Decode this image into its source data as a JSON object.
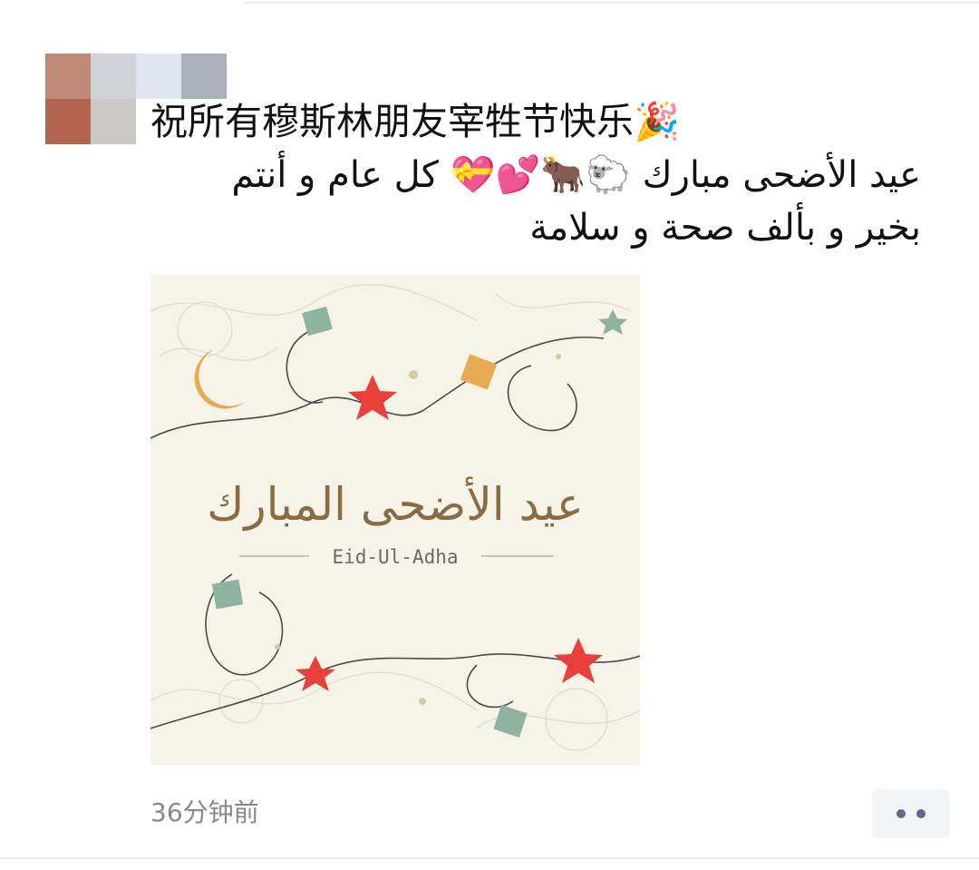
{
  "post": {
    "line_cn": "祝所有穆斯林朋友宰牲节快乐🎉",
    "line_ar_1": "عيد الأضحى مبارك 🐑🐂💕💝 كل عام و أنتم",
    "line_ar_2": "بخير و بألف صحة و سلامة"
  },
  "image": {
    "arabic_calligraphy": "عيد الأضحى المبارك",
    "caption": "Eid-Ul-Adha"
  },
  "footer": {
    "timestamp": "36分钟前"
  },
  "colors": {
    "card_bg": "#f6f3e9",
    "gold": "#e7aa52",
    "sage": "#8fb3a1",
    "red": "#e8413c",
    "calligraphy": "#8a6b44",
    "more_dots": "#5c6b8a"
  },
  "icons": {
    "avatar": "blurred-avatar",
    "more": "more-dots-icon"
  }
}
